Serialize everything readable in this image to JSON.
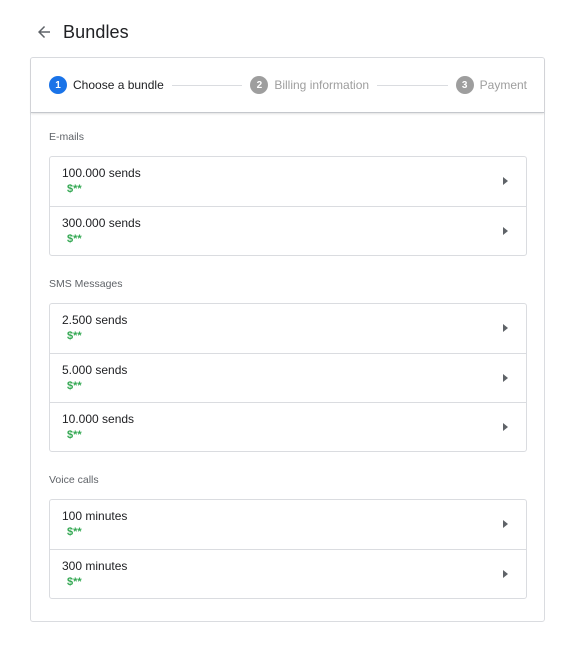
{
  "header": {
    "title": "Bundles",
    "back_icon": "arrow-back-icon"
  },
  "stepper": {
    "steps": [
      {
        "number": "1",
        "label": "Choose a bundle",
        "active": true
      },
      {
        "number": "2",
        "label": "Billing information",
        "active": false
      },
      {
        "number": "3",
        "label": "Payment",
        "active": false
      }
    ],
    "active_color": "#1a73e8",
    "inactive_color": "#9e9e9e"
  },
  "sections": [
    {
      "title": "E-mails",
      "items": [
        {
          "name": "100.000 sends",
          "price": "$**"
        },
        {
          "name": "300.000 sends",
          "price": "$**"
        }
      ]
    },
    {
      "title": "SMS Messages",
      "items": [
        {
          "name": "2.500 sends",
          "price": "$**"
        },
        {
          "name": "5.000 sends",
          "price": "$**"
        },
        {
          "name": "10.000 sends",
          "price": "$**"
        }
      ]
    },
    {
      "title": "Voice calls",
      "items": [
        {
          "name": "100 minutes",
          "price": "$**"
        },
        {
          "name": "300 minutes",
          "price": "$**"
        }
      ]
    }
  ],
  "price_color": "#34a853",
  "item_arrow_icon": "arrow-right-icon"
}
